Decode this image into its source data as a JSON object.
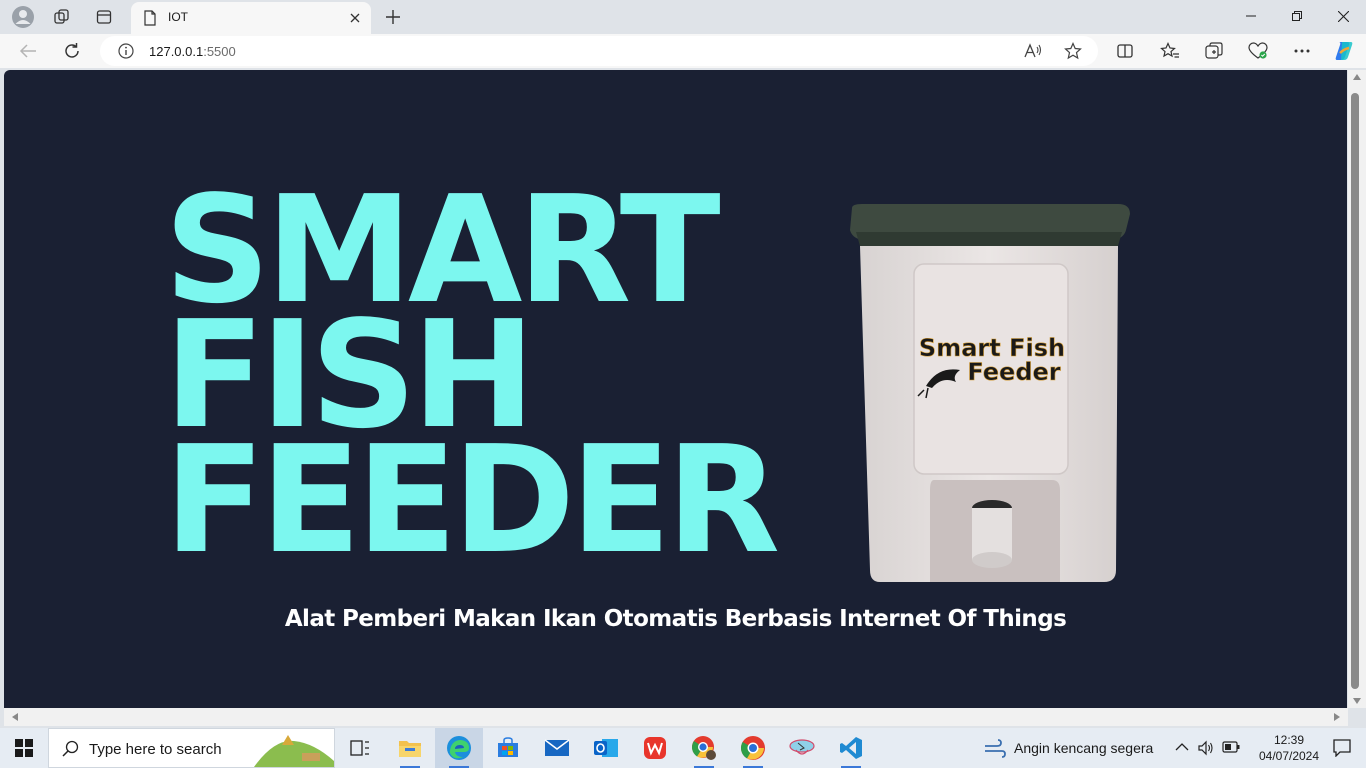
{
  "browser": {
    "tab": {
      "title": "IOT"
    },
    "address": {
      "host": "127.0.0.1",
      "port": ":5500"
    }
  },
  "page": {
    "hero_lines": [
      "SMART",
      "FISH",
      "FEEDER"
    ],
    "tagline": "Alat Pemberi Makan Ikan Otomatis Berbasis Internet Of Things",
    "product_label": {
      "line1": "Smart Fish",
      "line2": "Feeder"
    },
    "colors": {
      "background": "#1a2033",
      "title": "#7cf7ef",
      "tagline": "#ffffff"
    }
  },
  "taskbar": {
    "search_placeholder": "Type here to search",
    "weather": "Angin kencang segera",
    "time": "12:39",
    "date": "04/07/2024",
    "apps": [
      "task-view",
      "file-explorer",
      "edge",
      "microsoft-store",
      "mail",
      "outlook",
      "wps-office",
      "chrome-profile",
      "chrome",
      "app-bird",
      "vscode"
    ]
  }
}
